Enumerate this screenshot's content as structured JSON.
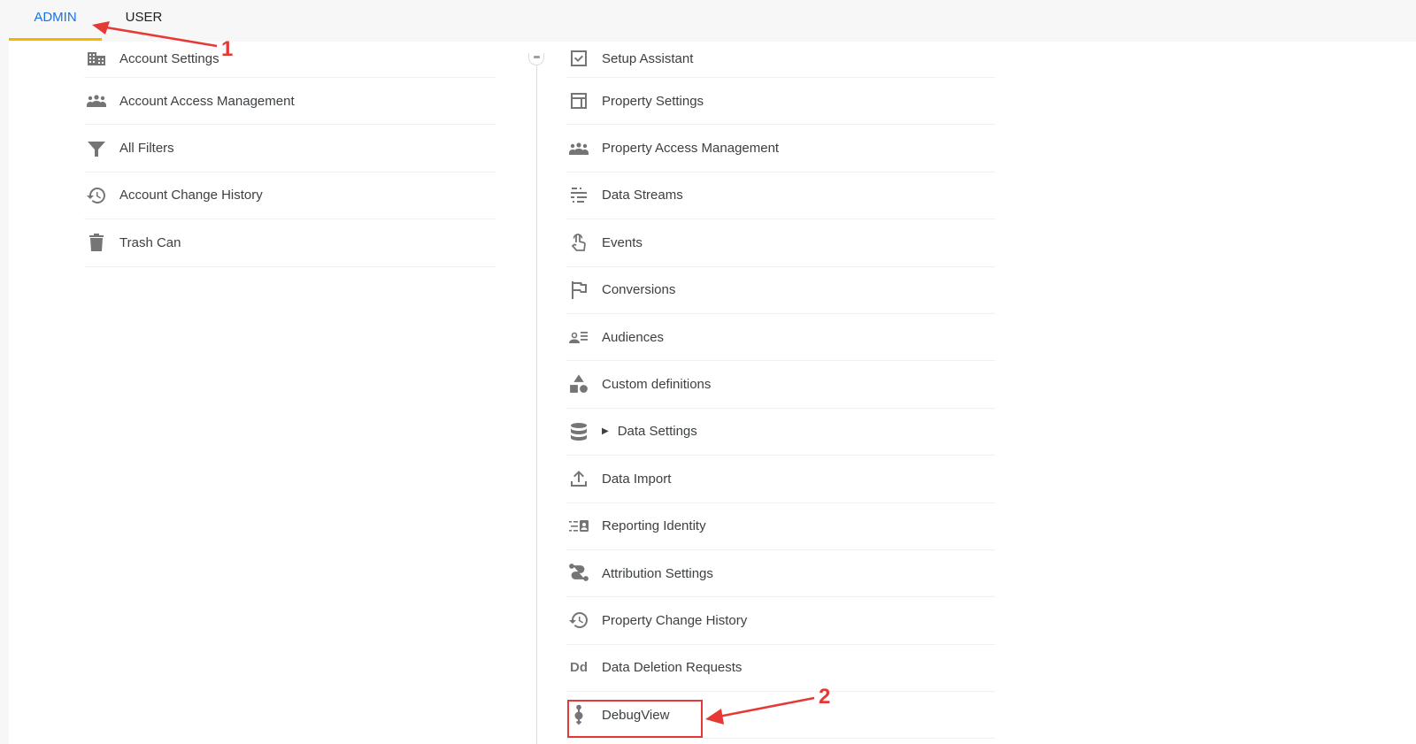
{
  "tabs": [
    {
      "label": "ADMIN",
      "active": true
    },
    {
      "label": "USER",
      "active": false
    }
  ],
  "account_column": {
    "items": [
      {
        "label": "Account Settings",
        "icon": "building-icon"
      },
      {
        "label": "Account Access Management",
        "icon": "people-icon"
      },
      {
        "label": "All Filters",
        "icon": "filter-icon"
      },
      {
        "label": "Account Change History",
        "icon": "history-icon"
      },
      {
        "label": "Trash Can",
        "icon": "trash-icon"
      }
    ]
  },
  "property_column": {
    "items": [
      {
        "label": "Setup Assistant",
        "icon": "checkbox-icon"
      },
      {
        "label": "Property Settings",
        "icon": "layout-icon"
      },
      {
        "label": "Property Access Management",
        "icon": "people-icon"
      },
      {
        "label": "Data Streams",
        "icon": "streams-icon"
      },
      {
        "label": "Events",
        "icon": "touch-icon"
      },
      {
        "label": "Conversions",
        "icon": "flag-icon"
      },
      {
        "label": "Audiences",
        "icon": "audience-icon"
      },
      {
        "label": "Custom definitions",
        "icon": "shapes-icon"
      },
      {
        "label": "Data Settings",
        "icon": "database-icon",
        "expandable": true
      },
      {
        "label": "Data Import",
        "icon": "upload-icon"
      },
      {
        "label": "Reporting Identity",
        "icon": "identity-icon"
      },
      {
        "label": "Attribution Settings",
        "icon": "attribution-icon"
      },
      {
        "label": "Property Change History",
        "icon": "history-icon"
      },
      {
        "label": "Data Deletion Requests",
        "icon": "deletion-icon",
        "icon_text": "Dd"
      },
      {
        "label": "DebugView",
        "icon": "debug-icon"
      }
    ]
  },
  "annotations": {
    "step1": "1",
    "step2": "2",
    "color": "#e53935"
  },
  "colors": {
    "active_tab_text": "#1a73e8",
    "active_tab_underline": "#f4b400"
  }
}
